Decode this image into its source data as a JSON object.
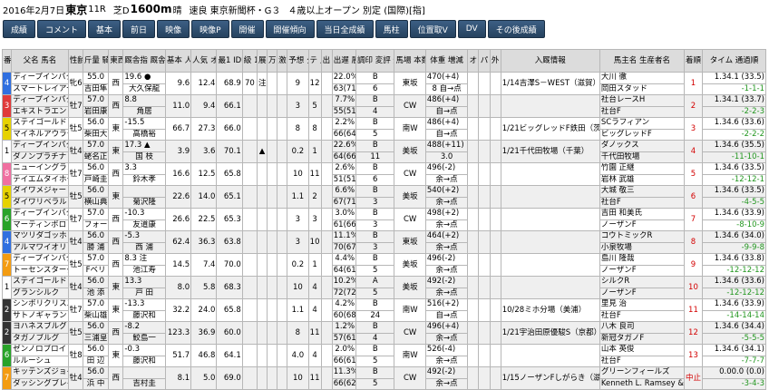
{
  "header": {
    "date": "2016年2月7日",
    "venue": "東京",
    "race_no": "11R",
    "surface": "芝D",
    "distance": "1600m",
    "weather": "晴",
    "race_name": "速良 東京新聞杯・G３",
    "conditions": "４歳以上オープン 別定 (国際)[指]"
  },
  "toolbar": {
    "buttons": [
      "成績",
      "コメント",
      "基本",
      "前日",
      "映像",
      "映像P",
      "開催",
      "開催傾向",
      "当日全成績",
      "馬柱",
      "位置取V",
      "DV",
      "その後成績"
    ]
  },
  "columns": [
    "番",
    "父名 馬名",
    "性齢",
    "斤量 騎手",
    "東西 所属",
    "厩舎指 厩舎化",
    "基本 人気",
    "人気 オッズ",
    "最1 IDM",
    "級 1",
    "展",
    "万",
    "激",
    "予想 夕差",
    "テ 上",
    "出 3",
    "出遅 展開",
    "調印 変評 追切指",
    "馬場 本数 追込",
    "体重 増減",
    "オ",
    "パ",
    "外",
    "入厩情報",
    "馬主名 生産者名",
    "着順",
    "タイム 通過順"
  ],
  "rows": [
    {
      "no": "4",
      "waku": "w4",
      "sire": "ディープインパクト",
      "name": "スマートレイアー",
      "sex": "牝6",
      "weight": "55.0",
      "jockey": "吉田隼",
      "ew": "西",
      "tag1": "19.6 ●",
      "trainer": "大久保龍",
      "ninki": "9.6",
      "odds": "12.4",
      "idm": "68.9",
      "kyu": "70",
      "ten": "注",
      "yosou": "9",
      "ago": "12",
      "deokure": "22.0%",
      "tyokyo": "B",
      "chokyo2": "63(71)",
      "baba": "東坂",
      "hon": "6",
      "weight2": "470(+4)",
      "zougen": "8 自→点",
      "nyukyu": "1/14吉澤S－WEST（滋賀）",
      "owner": "大川 徹",
      "breeder": "岡田スタッド",
      "chaku": "1",
      "time": "1.34.1 (33.5)",
      "tsuka": "-1-1-1"
    },
    {
      "no": "3",
      "waku": "w3",
      "sire": "ディープインパクト",
      "name": "エキストラエンド",
      "sex": "牡7",
      "weight": "57.0",
      "jockey": "岩田康",
      "ew": "西",
      "tag1": "8.8",
      "trainer": "角居",
      "ninki": "11.0",
      "odds": "9.4",
      "idm": "66.1",
      "kyu": "",
      "ten": "",
      "yosou": "3",
      "ago": "5",
      "deokure": "7.7%",
      "tyokyo": "B",
      "chokyo2": "55(51)",
      "baba": "CW",
      "hon": "4",
      "weight2": "486(+4)",
      "zougen": "自→点",
      "nyukyu": "",
      "owner": "社台レースH",
      "breeder": "社台F",
      "chaku": "2",
      "time": "1.34.1 (33.7)",
      "tsuka": "-2-2-3"
    },
    {
      "no": "5",
      "waku": "w5",
      "sire": "ステイゴールド",
      "name": "マイネルアウラート",
      "sex": "牡5",
      "weight": "56.0",
      "jockey": "柴田大",
      "ew": "東",
      "tag1": "-15.5",
      "trainer": "高橋裕",
      "ninki": "66.7",
      "odds": "27.3",
      "idm": "66.0",
      "kyu": "",
      "ten": "",
      "yosou": "8",
      "ago": "8",
      "deokure": "2.2%",
      "tyokyo": "B",
      "chokyo2": "66(64)",
      "baba": "南W",
      "hon": "5",
      "weight2": "486(+4)",
      "zougen": "自→点",
      "nyukyu": "1/21ビッグレッドF鉄田（茨城）",
      "owner": "SCラフィアン",
      "breeder": "ビッグレッドF",
      "chaku": "3",
      "time": "1.34.6 (33.6)",
      "tsuka": "-2-2-2"
    },
    {
      "no": "1",
      "waku": "w1",
      "sire": "ディープインパクト",
      "name": "ダノンプラチナ",
      "sex": "牡4",
      "weight": "57.0",
      "jockey": "蛯名正",
      "ew": "東",
      "tag1": "17.3 ▲",
      "trainer": "国 枝",
      "ninki": "3.9",
      "odds": "3.6",
      "idm": "70.1",
      "kyu": "",
      "ten": "▲",
      "yosou": "0.2",
      "ago": "1",
      "deokure": "22.6%",
      "tyokyo": "B",
      "chokyo2": "64(66)",
      "baba": "美坂",
      "hon": "11",
      "weight2": "488(+11)",
      "zougen": "3.0",
      "nyukyu": "1/21千代田牧場（千葉）",
      "owner": "ダノックス",
      "breeder": "千代田牧場",
      "chaku": "4",
      "time": "1.34.6 (35.5)",
      "tsuka": "-11-10-1"
    },
    {
      "no": "8",
      "waku": "w8",
      "sire": "ニューイングランド",
      "name": "テイエムタイホー",
      "sex": "牡7",
      "weight": "56.0",
      "jockey": "戸崎圭",
      "ew": "西",
      "tag1": "3.3",
      "trainer": "鈴木孝",
      "ninki": "16.6",
      "odds": "12.5",
      "idm": "65.8",
      "kyu": "",
      "ten": "",
      "yosou": "10",
      "ago": "11",
      "deokure": "2.6%",
      "tyokyo": "B",
      "chokyo2": "51(51)",
      "baba": "CW",
      "hon": "6",
      "weight2": "496(-2)",
      "zougen": "余→点",
      "nyukyu": "",
      "owner": "竹園 正継",
      "breeder": "岩林 武雄",
      "chaku": "5",
      "time": "1.34.6 (33.5)",
      "tsuka": "-12-12-1"
    },
    {
      "no": "5",
      "waku": "w5",
      "sire": "ダイワメジャー",
      "name": "ダイワリベラル",
      "sex": "牡5",
      "weight": "56.0",
      "jockey": "横山典",
      "ew": "東",
      "tag1": "",
      "trainer": "菊沢隆",
      "ninki": "22.6",
      "odds": "14.0",
      "idm": "65.1",
      "kyu": "",
      "ten": "",
      "yosou": "1.1",
      "ago": "2",
      "deokure": "6.6%",
      "tyokyo": "B",
      "chokyo2": "67(71)",
      "baba": "美坂",
      "hon": "3",
      "weight2": "540(+2)",
      "zougen": "余→点",
      "nyukyu": "",
      "owner": "大城 敬三",
      "breeder": "社台F",
      "chaku": "6",
      "time": "1.34.6 (33.5)",
      "tsuka": "-4-5-5"
    },
    {
      "no": "6",
      "waku": "w6",
      "sire": "ディープインパクト",
      "name": "マーティンボロ",
      "sex": "牡7",
      "weight": "57.0",
      "jockey": "フォー",
      "ew": "西",
      "tag1": "-10.3",
      "trainer": "友道康",
      "ninki": "26.6",
      "odds": "22.5",
      "idm": "65.3",
      "kyu": "",
      "ten": "",
      "yosou": "3",
      "ago": "3",
      "deokure": "3.0%",
      "tyokyo": "B",
      "chokyo2": "61(66)",
      "baba": "CW",
      "hon": "3",
      "weight2": "498(+2)",
      "zougen": "余→点",
      "nyukyu": "",
      "owner": "吉田 和美氏",
      "breeder": "ノーザンF",
      "chaku": "7",
      "time": "1.34.6 (33.9)",
      "tsuka": "-8-10-9"
    },
    {
      "no": "4",
      "waku": "w4",
      "sire": "マツリダゴッホ",
      "name": "アルマワイオリ",
      "sex": "牡4",
      "weight": "56.0",
      "jockey": "勝 浦",
      "ew": "西",
      "tag1": "-5.3",
      "trainer": "西 浦",
      "ninki": "62.4",
      "odds": "36.3",
      "idm": "63.8",
      "kyu": "",
      "ten": "",
      "yosou": "3",
      "ago": "10",
      "deokure": "11.1%",
      "tyokyo": "B",
      "chokyo2": "70(67)",
      "baba": "東坂",
      "hon": "3",
      "weight2": "464(+2)",
      "zougen": "余→点",
      "nyukyu": "",
      "owner": "コウトミックR",
      "breeder": "小泉牧場",
      "chaku": "8",
      "time": "1.34.6 (34.0)",
      "tsuka": "-9-9-8"
    },
    {
      "no": "7",
      "waku": "w7",
      "sire": "ディープインパクト",
      "name": "トーセンスターダム",
      "sex": "牡5",
      "weight": "57.0",
      "jockey": "Fベリ",
      "ew": "西",
      "tag1": "8.3 注",
      "trainer": "池江寿",
      "ninki": "14.5",
      "odds": "7.4",
      "idm": "70.0",
      "kyu": "",
      "ten": "",
      "yosou": "0.2",
      "ago": "1",
      "deokure": "4.4%",
      "tyokyo": "B",
      "chokyo2": "64(61)",
      "baba": "美坂",
      "hon": "5",
      "weight2": "496(-2)",
      "zougen": "余→点",
      "nyukyu": "",
      "owner": "島川 隆哉",
      "breeder": "ノーザンF",
      "chaku": "9",
      "time": "1.34.6 (33.8)",
      "tsuka": "-12-12-12"
    },
    {
      "no": "1",
      "waku": "w1",
      "sire": "ステイゴールド",
      "name": "グランシルク",
      "sex": "牡4",
      "weight": "56.0",
      "jockey": "池 添",
      "ew": "東",
      "tag1": "13.3",
      "trainer": "戸 田",
      "ninki": "8.0",
      "odds": "5.8",
      "idm": "68.3",
      "kyu": "",
      "ten": "",
      "yosou": "10",
      "ago": "4",
      "deokure": "10.2%",
      "tyokyo": "A",
      "chokyo2": "72(72)",
      "baba": "美坂",
      "hon": "5",
      "weight2": "492(-2)",
      "zougen": "余→点",
      "nyukyu": "",
      "owner": "シルクR",
      "breeder": "ノーザンF",
      "chaku": "10",
      "time": "1.34.6 (33.6)",
      "tsuka": "-12-12-12"
    },
    {
      "no": "2",
      "waku": "w2",
      "sire": "シンボリクリスエス",
      "name": "サトノギャラント",
      "sex": "牡7",
      "weight": "57.0",
      "jockey": "柴山雄",
      "ew": "東",
      "tag1": "-13.3",
      "trainer": "藤沢和",
      "ninki": "32.2",
      "odds": "24.0",
      "idm": "65.8",
      "kyu": "",
      "ten": "",
      "yosou": "1.1",
      "ago": "4",
      "deokure": "4.2%",
      "tyokyo": "B",
      "chokyo2": "60(68)",
      "baba": "南W",
      "hon": "24",
      "weight2": "516(+2)",
      "zougen": "自→点",
      "nyukyu": "10/28ミホ分場（美浦）",
      "owner": "里見 治",
      "breeder": "社台F",
      "chaku": "11",
      "time": "1.34.6 (33.9)",
      "tsuka": "-14-14-14"
    },
    {
      "no": "2",
      "waku": "w2",
      "sire": "ヨハネスブルグ",
      "name": "タガノブルグ",
      "sex": "牡5",
      "weight": "56.0",
      "jockey": "三浦皇",
      "ew": "西",
      "tag1": "-8.2",
      "trainer": "鮫島一",
      "ninki": "123.3",
      "odds": "36.9",
      "idm": "60.0",
      "kyu": "",
      "ten": "",
      "yosou": "8",
      "ago": "11",
      "deokure": "1.2%",
      "tyokyo": "B",
      "chokyo2": "57(61)",
      "baba": "CW",
      "hon": "4",
      "weight2": "496(+4)",
      "zougen": "余→点",
      "nyukyu": "1/21宇治田原優駿S（京都）",
      "owner": "八木 良司",
      "breeder": "新冠タガノF",
      "chaku": "12",
      "time": "1.34.6 (34.4)",
      "tsuka": "-5-5-5"
    },
    {
      "no": "6",
      "waku": "w6",
      "sire": "ゼンノロブロイ",
      "name": "ルルーシュ",
      "sex": "牡8",
      "weight": "56.0",
      "jockey": "田 辺",
      "ew": "東",
      "tag1": "-0.3",
      "trainer": "藤沢和",
      "ninki": "51.7",
      "odds": "46.8",
      "idm": "64.1",
      "kyu": "",
      "ten": "",
      "yosou": "4.0",
      "ago": "4",
      "deokure": "2.0%",
      "tyokyo": "B",
      "chokyo2": "66(61)",
      "baba": "南W",
      "hon": "5",
      "weight2": "526(-4)",
      "zougen": "余→点",
      "nyukyu": "",
      "owner": "山本 英俊",
      "breeder": "社台F",
      "chaku": "13",
      "time": "1.34.6 (34.1)",
      "tsuka": "-7-7-7"
    },
    {
      "no": "7",
      "waku": "w7",
      "sire": "キッテンズジョイ",
      "name": "ダッシングブレイズ",
      "sex": "牡4",
      "weight": "56.0",
      "jockey": "浜 中",
      "ew": "西",
      "tag1": "",
      "trainer": "吉村圭",
      "ninki": "8.1",
      "odds": "5.0",
      "idm": "69.0",
      "kyu": "",
      "ten": "",
      "yosou": "10",
      "ago": "11",
      "deokure": "11.3%",
      "tyokyo": "B",
      "chokyo2": "66(62)",
      "baba": "CW",
      "hon": "5",
      "weight2": "492(-2)",
      "zougen": "余→点",
      "nyukyu": "1/15ノーザンFしがらき（滋賀）",
      "owner": "グリーンフィールズ",
      "breeder": "Kenneth L. Ramsey &",
      "chaku": "中止",
      "time": "0.00.0 (0.0)",
      "tsuka": "-3-4-3"
    }
  ]
}
